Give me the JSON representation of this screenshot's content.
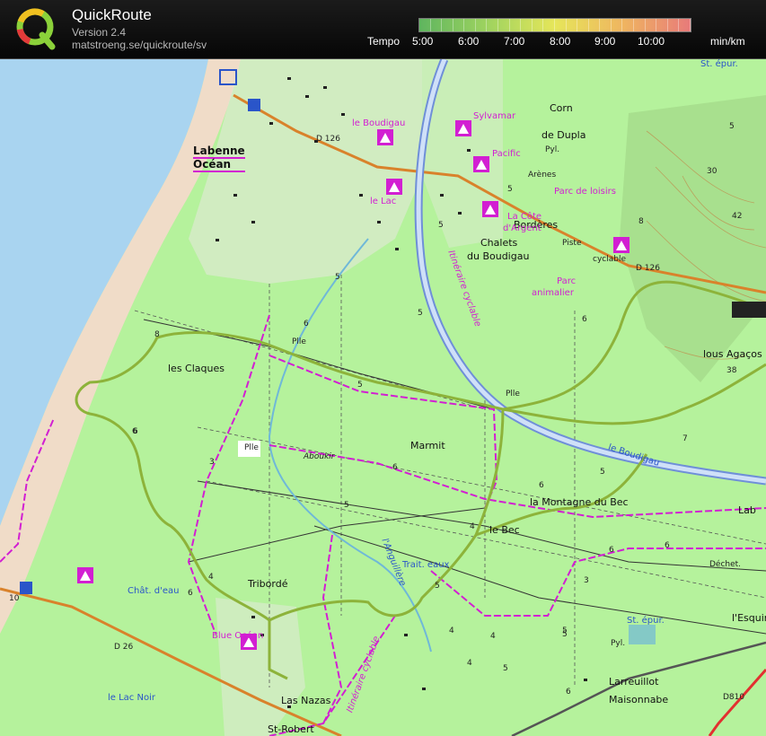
{
  "app": {
    "title": "QuickRoute",
    "version": "Version 2.4",
    "url": "matstroeng.se/quickroute/sv"
  },
  "tempo": {
    "label": "Tempo",
    "ticks": [
      "5:00",
      "6:00",
      "7:00",
      "8:00",
      "9:00",
      "10:00"
    ],
    "unit": "min/km",
    "gradient_colors": [
      "#5fb55f",
      "#9ed35f",
      "#e6e65a",
      "#efb560",
      "#e87a7a"
    ]
  },
  "map": {
    "colors": {
      "sea": "#a9d4f0",
      "land": "#b5f29c",
      "beach": "#f0dcc8",
      "route": "#8db33a",
      "trail": "#d21fd2",
      "road": "#d9822b",
      "canal": "#6f8fd8"
    },
    "place_labels": {
      "labenne_1": "Labenne",
      "labenne_2": "Océan",
      "les_claques": "les Claques",
      "marmit": "Marmit",
      "la_montagne": "la Montagne du Bec",
      "le_bec": "le Bec",
      "tribord": "Tribordé",
      "las_nazas": "Las Nazas",
      "st_robert": "St-Robert",
      "chalets_1": "Chalets",
      "chalets_2": "du Boudigau",
      "corn": "Corn",
      "de_dupla": "de Dupla",
      "arenes": "Arènes",
      "borderes": "Bordères",
      "lous_agacos": "lous Agaços",
      "larreuillot": "Larreuillot",
      "maisonnabe": "Maisonnabe",
      "l_esquire": "l'Esquire",
      "dechet": "Déchet.",
      "lab": "Lab",
      "aboukir": "Aboukir",
      "pyl_1": "Pyl.",
      "pyl_2": "Pyl.",
      "plle_1": "Plle",
      "plle_2": "Plle",
      "plle_3": "Plle",
      "piste": "Piste",
      "cyclable": "cyclable",
      "d126_1": "D 126",
      "d126_2": "D 126",
      "d26": "D 26",
      "d810": "D810"
    },
    "poi_labels": {
      "le_boudigau": "le Boudigau",
      "sylvamar": "Sylvamar",
      "pacific": "Pacific",
      "le_lac": "le Lac",
      "parc_loisirs": "Parc de loisirs",
      "cote_argent_1": "La Côte",
      "cote_argent_2": "d'Argent",
      "parc_animalier_1": "Parc",
      "parc_animalier_2": "animalier",
      "blue_ocean": "Blue Océan",
      "itineraire_1": "Itinéraire cyclable",
      "itineraire_2": "Itinéraire cyclable"
    },
    "water_labels": {
      "le_boudigau_river": "le Boudigau",
      "anguillere": "l'Anguillère",
      "trait_eaux": "Trait. eaux",
      "chat_deau": "Chât. d'eau",
      "le_lac_noir": "le Lac Noir",
      "st_epur_1": "St. épur.",
      "st_epur_2": "St. épur."
    },
    "contour_numbers": [
      "8",
      "5",
      "6",
      "5",
      "5",
      "5",
      "6",
      "6",
      "7",
      "5",
      "6",
      "4",
      "4",
      "3",
      "5",
      "5",
      "6",
      "5",
      "6",
      "3",
      "4",
      "4",
      "5",
      "6",
      "6",
      "5",
      "4",
      "6",
      "30",
      "42",
      "38",
      "10",
      "6",
      "5",
      "8",
      "5"
    ]
  }
}
